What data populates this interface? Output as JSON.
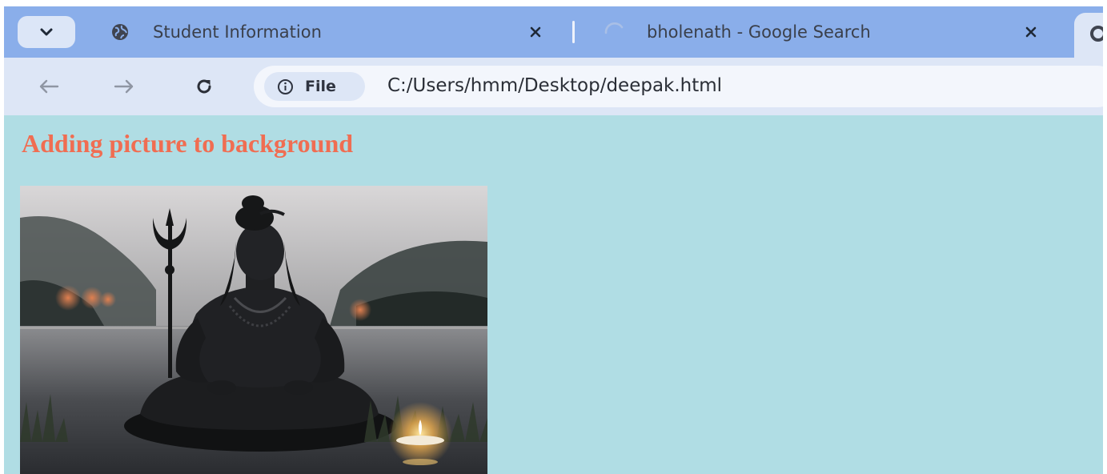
{
  "browser": {
    "tabs": [
      {
        "title": "Student Information",
        "favicon": "globe-icon",
        "active": false
      },
      {
        "title": "bholenath - Google Search",
        "favicon": "loading-spinner-icon",
        "active": false
      }
    ],
    "toolbar": {
      "site_chip_label": "File",
      "url": "C:/Users/hmm/Desktop/deepak.html"
    }
  },
  "page": {
    "background_color": "#b0dde4",
    "heading": "Adding picture to background",
    "heading_color": "#f06d52",
    "image_subject": "Lord Shiva meditation statue with trident, lake and candle"
  }
}
